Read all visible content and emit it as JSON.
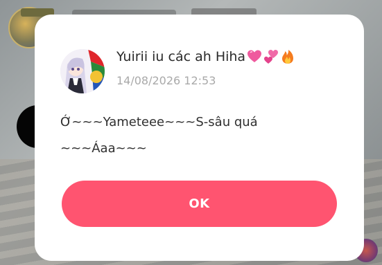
{
  "dialog": {
    "author_name": "Yuirii iu các ah Hiha",
    "author_emojis": [
      "pink-heart-icon",
      "two-hearts-icon",
      "fire-icon"
    ],
    "timestamp": "14/08/2026 12:53",
    "message_lines": [
      "Ớ~~~Yameteee~~~S-sâu quá",
      "~~~Áaa~~~"
    ],
    "ok_label": "OK"
  },
  "colors": {
    "accent": "#ff5470",
    "dialog_bg": "#ffffff",
    "timestamp_text": "#a9a9a9",
    "body_text": "#2f2f2f"
  }
}
